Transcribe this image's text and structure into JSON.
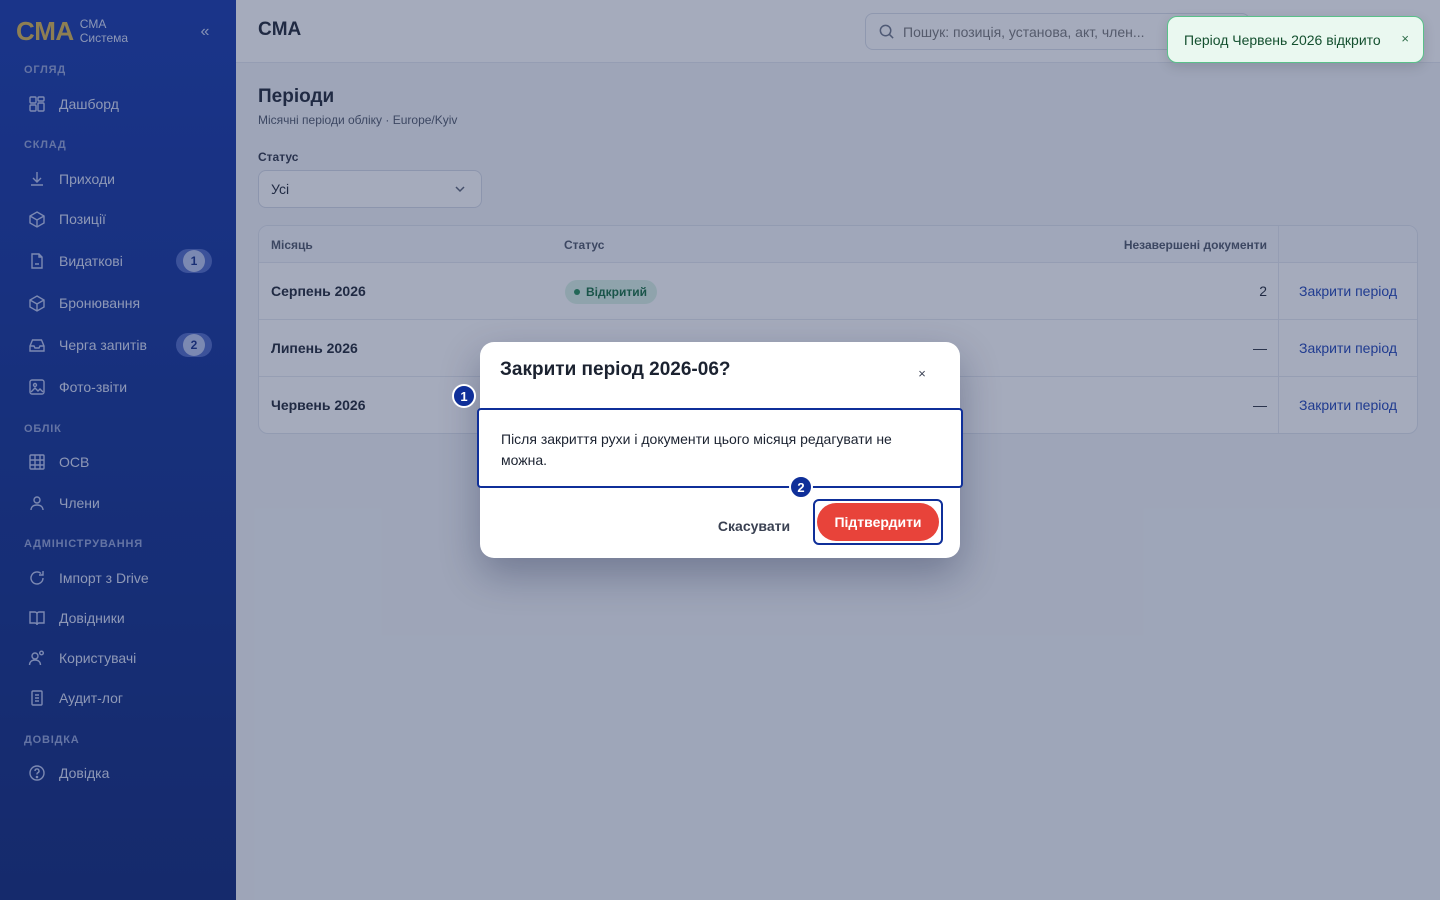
{
  "brand": {
    "logo": "CMA",
    "line1": "CMA",
    "line2": "Система",
    "collapse": "«"
  },
  "sidebar": {
    "sections": [
      {
        "title": "ОГЛЯД"
      },
      {
        "title": "СКЛАД"
      },
      {
        "title": "ОБЛІК"
      },
      {
        "title": "АДМІНІСТРУВАННЯ"
      },
      {
        "title": "ДОВІДКА"
      }
    ],
    "items": [
      {
        "label": "Дашборд",
        "icon": "dashboard-icon"
      },
      {
        "label": "Приходи",
        "icon": "download-icon"
      },
      {
        "label": "Позиції",
        "icon": "box-icon"
      },
      {
        "label": "Видаткові",
        "icon": "document-icon",
        "badge": "1"
      },
      {
        "label": "Бронювання",
        "icon": "box-icon"
      },
      {
        "label": "Черга запитів",
        "icon": "inbox-icon",
        "badge": "2"
      },
      {
        "label": "Фото-звіти",
        "icon": "image-icon"
      },
      {
        "label": "ОСВ",
        "icon": "table-icon"
      },
      {
        "label": "Члени",
        "icon": "user-icon"
      },
      {
        "label": "Імпорт з Drive",
        "icon": "refresh-icon"
      },
      {
        "label": "Довідники",
        "icon": "book-icon"
      },
      {
        "label": "Користувачі",
        "icon": "users-icon"
      },
      {
        "label": "Аудит-лог",
        "icon": "log-icon"
      },
      {
        "label": "Довідка",
        "icon": "help-icon"
      }
    ]
  },
  "header": {
    "title": "CMA",
    "search_placeholder": "Пошук: позиція, установа, акт, член..."
  },
  "page": {
    "title": "Періоди",
    "subtitle": "Місячні періоди обліку · Europe/Kyiv",
    "filter_label": "Статус",
    "filter_value": "Усі"
  },
  "table": {
    "headers": {
      "month": "Місяць",
      "status": "Статус",
      "docs": "Незавершені документи"
    },
    "rows": [
      {
        "month": "Серпень 2026",
        "status": "Відкритий",
        "docs": "2",
        "action": "Закрити період"
      },
      {
        "month": "Липень 2026",
        "status": "",
        "docs": "—",
        "action": "Закрити період"
      },
      {
        "month": "Червень 2026",
        "status": "",
        "docs": "—",
        "action": "Закрити період"
      }
    ]
  },
  "toast": {
    "text": "Період Червень 2026 відкрито",
    "close": "×"
  },
  "modal": {
    "title": "Закрити період 2026-06?",
    "close": "×",
    "body": "Після закриття рухи і документи цього місяця редагувати не можна.",
    "cancel": "Скасувати",
    "confirm": "Підтвердити"
  },
  "markers": [
    "1",
    "2"
  ],
  "colors": {
    "sidebar": "#0b2a8c",
    "accent": "#1a3fb3",
    "danger": "#e8433a",
    "brand_gold": "#d8b34a",
    "success": "#1f8a51"
  }
}
